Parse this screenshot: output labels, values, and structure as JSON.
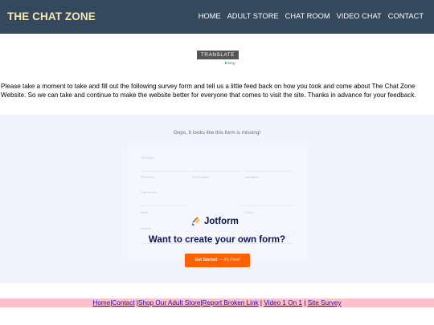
{
  "header": {
    "title": "THE CHAT ZONE",
    "nav": [
      "HOME",
      "ADULT STORE",
      "CHAT ROOM",
      "VIDEO CHAT",
      "CONTACT"
    ]
  },
  "translate": {
    "label": "TRANSLATE",
    "powered_by": "bing"
  },
  "intro": "Please take a moment to take and fill out the following survey form and tell us a little feed back on how you took and come about The Chat Zone Website. So we can take and continue to make the website better for everyone that comes to visit the site. Thanks in advance for your feedback.",
  "form_embed": {
    "missing_message": "Oops, It looks like this form is missing!",
    "brand": "Jotform",
    "headline": "Want to create your own form?",
    "button_main": "Get Started",
    "button_sub": "— It's Free!",
    "ghost_labels": [
      "Full Name",
      "First Name",
      "Middle Name",
      "Last Name",
      "Date of birth",
      "Email",
      "Address",
      "Phone"
    ]
  },
  "footer": {
    "links": [
      "Home",
      "Contact",
      "Shop Our Adult Store",
      "Report Broken Link",
      "Video 1 On 1",
      "Site Survey"
    ]
  },
  "colors": {
    "header_bg": "#34495e",
    "title": "#f3e7b3",
    "form_bg": "#f3f3fe",
    "cta": "#ff6100",
    "footer_bg": "#ffc0cb"
  }
}
